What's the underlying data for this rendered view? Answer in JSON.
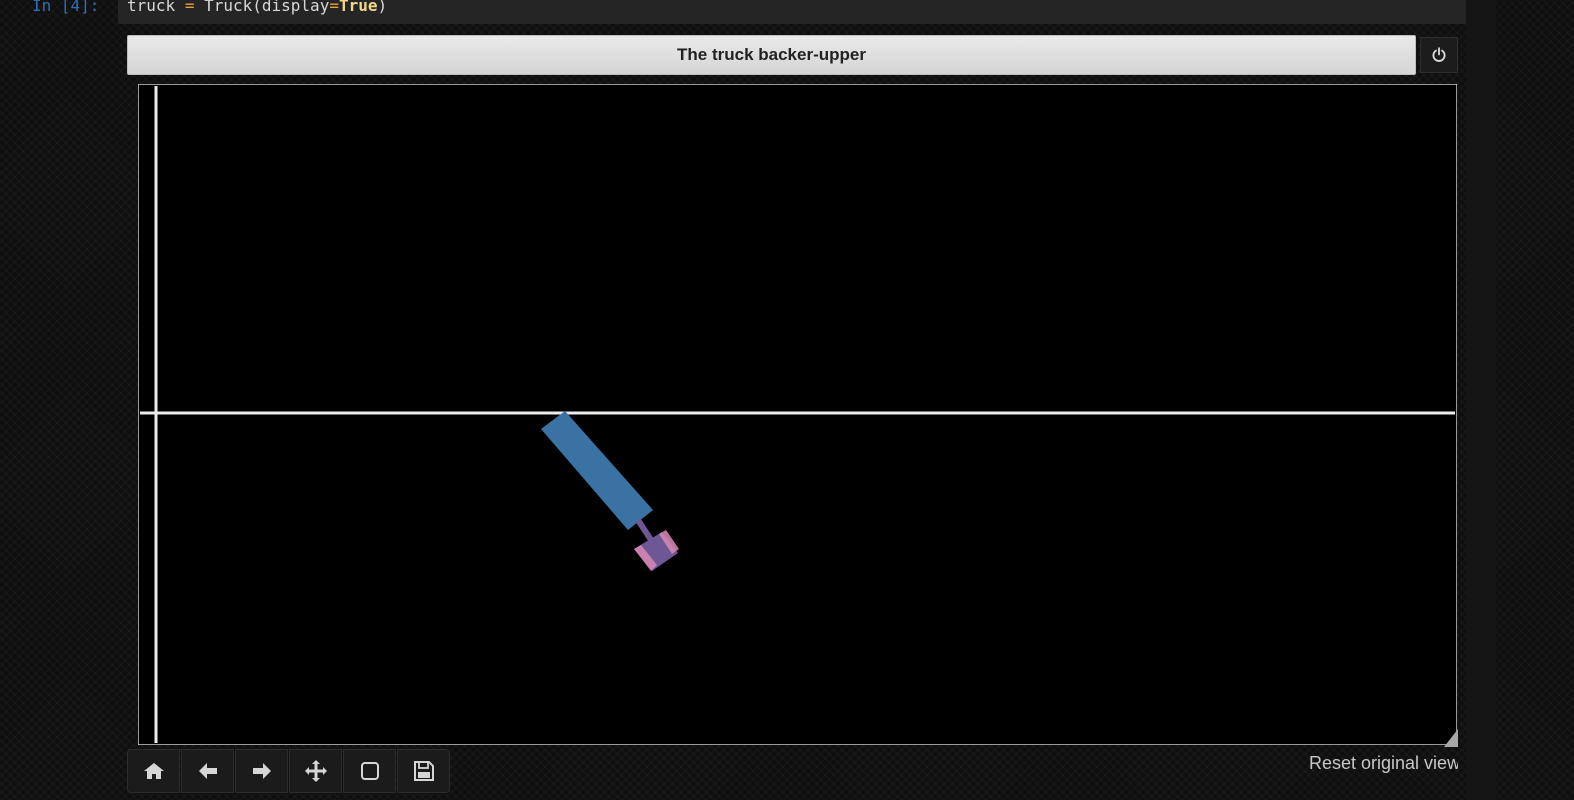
{
  "notebook": {
    "prompt": "In [4]:",
    "code": {
      "var": "truck",
      "op": "=",
      "call_open": "Truck(display",
      "kw_op": "=",
      "kw_value": "True",
      "close": ")"
    }
  },
  "figure": {
    "title": "The truck backer-upper",
    "power_icon": "power-icon",
    "scene": {
      "background": "#000000",
      "boundary_color": "#e8e8e8",
      "trailer_color": "#3a73a3",
      "cab_color": "#6d5794",
      "wheel_color": "#d98ab5"
    }
  },
  "toolbar": {
    "buttons": [
      {
        "name": "home-button",
        "icon": "home-icon"
      },
      {
        "name": "back-button",
        "icon": "arrow-left-icon"
      },
      {
        "name": "forward-button",
        "icon": "arrow-right-icon"
      },
      {
        "name": "pan-button",
        "icon": "move-icon"
      },
      {
        "name": "zoom-rect-button",
        "icon": "square-icon"
      },
      {
        "name": "save-button",
        "icon": "floppy-icon"
      }
    ],
    "status": "Reset original view"
  }
}
